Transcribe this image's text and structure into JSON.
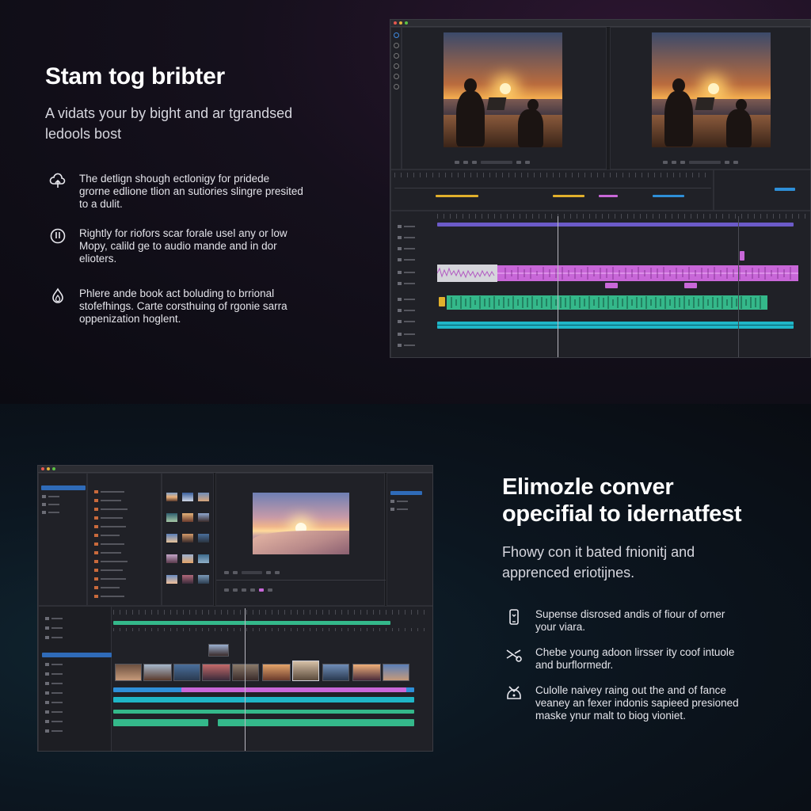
{
  "section_one": {
    "headline": "Stam tog bribter",
    "subtitle_line1": "A vidats your by bight and ar tgrandsed",
    "subtitle_line2": "ledools bost",
    "features": [
      {
        "icon": "cloud-upload-icon",
        "line1": "The detlign shough ectlonigy for pridede",
        "line2": "grorne edlione tlion an sutiories slingre presited",
        "line3": "to a dulit."
      },
      {
        "icon": "power-icon",
        "line1": "Rightly for riofors scar forale usel any or low",
        "line2": "Mopy, calild ge to audio mande and in dor",
        "line3": "elioters."
      },
      {
        "icon": "flame-icon",
        "line1": "Phlere ande book act boluding to brrional",
        "line2": "stofefhings. Carte corsthuing of rgonie sarra",
        "line3": "oppenization hoglent."
      }
    ]
  },
  "section_two": {
    "headline_line1": "Elimozle conver",
    "headline_line2": "opecifial to idernatfest",
    "subtitle_line1": "Fhowy con it bated fnionitj and",
    "subtitle_line2": "apprenced eriotijnes.",
    "features": [
      {
        "icon": "phone-icon",
        "line1": "Supense disrosed andis of fiour of orner",
        "line2": "your viara."
      },
      {
        "icon": "scissors-icon",
        "line1": "Chebe young adoon lirsser ity coof intuole",
        "line2": "and burflormedr."
      },
      {
        "icon": "handset-icon",
        "line1": "Culolle naivey raing out the and of fance",
        "line2": "veaney an fexer indonis sapieed presioned",
        "line3": "maske ynur malt to biog vioniet."
      }
    ]
  },
  "colors": {
    "audio_magenta": "#c867d8",
    "audio_green": "#34b88a",
    "audio_cyan": "#1fb6c7",
    "clip_yellow": "#e1b02c",
    "clip_blue": "#2e8fd8",
    "selection_blue": "#2f6bb8"
  }
}
